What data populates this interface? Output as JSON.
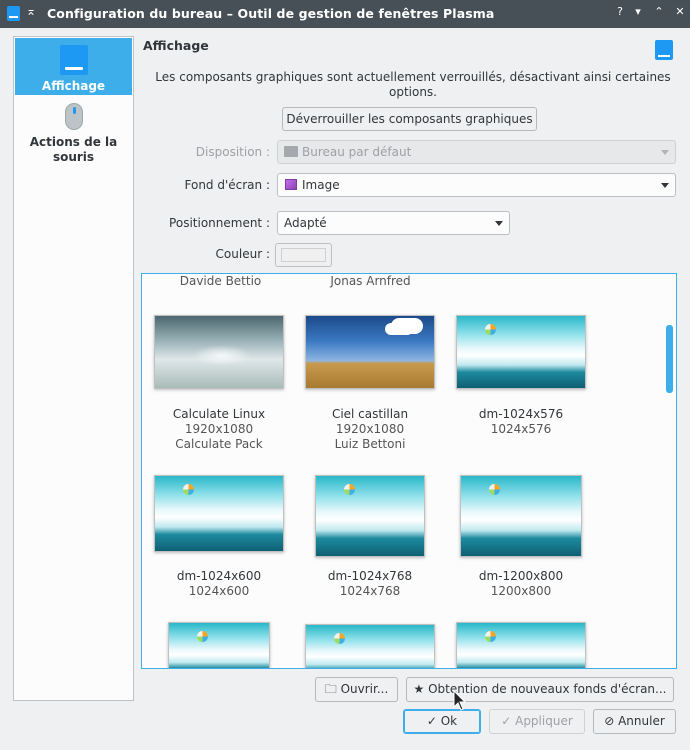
{
  "window": {
    "title": "Configuration du bureau – Outil de gestion de fenêtres Plasma",
    "buttons": [
      "?",
      "▾",
      "⌃",
      "✕"
    ]
  },
  "sidebar": {
    "items": [
      {
        "label": "Affichage",
        "icon": "display-icon",
        "active": true
      },
      {
        "label": "Actions de la souris",
        "icon": "mouse-icon",
        "active": false
      }
    ]
  },
  "page": {
    "title": "Affichage",
    "lock_message": "Les composants graphiques sont actuellement verrouillés, désactivant ainsi certaines options.",
    "unlock_button": "Déverrouiller les composants graphiques"
  },
  "form": {
    "layout_label": "Disposition :",
    "layout_value": "Bureau par défaut",
    "wallpaper_label": "Fond d'écran :",
    "wallpaper_value": "Image",
    "positioning_label": "Positionnement :",
    "positioning_value": "Adapté",
    "color_label": "Couleur :",
    "color_value": "#f0f0f0"
  },
  "gallery": {
    "top_authors": [
      "Davide Bettio",
      "Jonas Arnfred"
    ],
    "wallpapers": [
      {
        "name": "Calculate Linux",
        "size": "1920x1080",
        "author": "Calculate Pack"
      },
      {
        "name": "Ciel castillan",
        "size": "1920x1080",
        "author": "Luiz Bettoni"
      },
      {
        "name": "dm-1024x576",
        "size": "1024x576",
        "author": ""
      },
      {
        "name": "dm-1024x600",
        "size": "1024x600",
        "author": ""
      },
      {
        "name": "dm-1024x768",
        "size": "1024x768",
        "author": ""
      },
      {
        "name": "dm-1200x800",
        "size": "1200x800",
        "author": ""
      }
    ]
  },
  "actions": {
    "open": "Ouvrir...",
    "get_new": "Obtention de nouveaux fonds d'écran...",
    "ok": "Ok",
    "apply": "Appliquer",
    "cancel": "Annuler"
  },
  "colors": {
    "accent": "#3daee9",
    "titlebar": "#475057",
    "window_bg": "#eff0f1"
  }
}
